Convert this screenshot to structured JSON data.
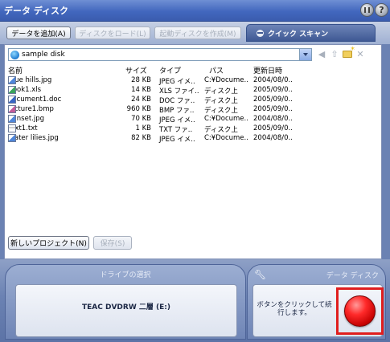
{
  "window": {
    "title": "データ ディスク"
  },
  "toolbar": {
    "add_data": "データを追加(A)",
    "load_disc": "ディスクをロード(L)",
    "create_boot_disc": "起動ディスクを作成(M)",
    "quick_scan": "クイック スキャン"
  },
  "pathbar": {
    "path": "sample disk"
  },
  "columns": {
    "name": "名前",
    "size": "サイズ",
    "type": "タイプ",
    "path": "パス",
    "date": "更新日時"
  },
  "files": [
    {
      "name": "Blue hills.jpg",
      "size": "28 KB",
      "type": "JPEG イメ..",
      "path": "C:¥Docume..",
      "date": "2004/08/0..",
      "icon": "jpg"
    },
    {
      "name": "Book1.xls",
      "size": "14 KB",
      "type": "XLS ファイ..",
      "path": "ディスク上",
      "date": "2005/09/0..",
      "icon": "xls"
    },
    {
      "name": "document1.doc",
      "size": "24 KB",
      "type": "DOC ファ..",
      "path": "ディスク上",
      "date": "2005/09/0..",
      "icon": "doc"
    },
    {
      "name": "picture1.bmp",
      "size": "960 KB",
      "type": "BMP ファ..",
      "path": "ディスク上",
      "date": "2005/09/0..",
      "icon": "bmp"
    },
    {
      "name": "Sunset.jpg",
      "size": "70 KB",
      "type": "JPEG イメ..",
      "path": "C:¥Docume..",
      "date": "2004/08/0..",
      "icon": "jpg"
    },
    {
      "name": "text1.txt",
      "size": "1 KB",
      "type": "TXT ファ..",
      "path": "ディスク上",
      "date": "2005/09/0..",
      "icon": "txt"
    },
    {
      "name": "Water lilies.jpg",
      "size": "82 KB",
      "type": "JPEG イメ..",
      "path": "C:¥Docume..",
      "date": "2004/08/0..",
      "icon": "jpg"
    }
  ],
  "bottom_buttons": {
    "new_project": "新しいプロジェクト(N)",
    "save": "保存(S)"
  },
  "drive": {
    "header": "ドライブの選択",
    "name": "TEAC DVDRW 二層 (E:)"
  },
  "burn": {
    "label": "データ ディスク",
    "help": "ボタンをクリックして続行します。"
  },
  "colors": {
    "highlight_frame": "#e01e1e",
    "record_button": "#ff2a2a"
  }
}
